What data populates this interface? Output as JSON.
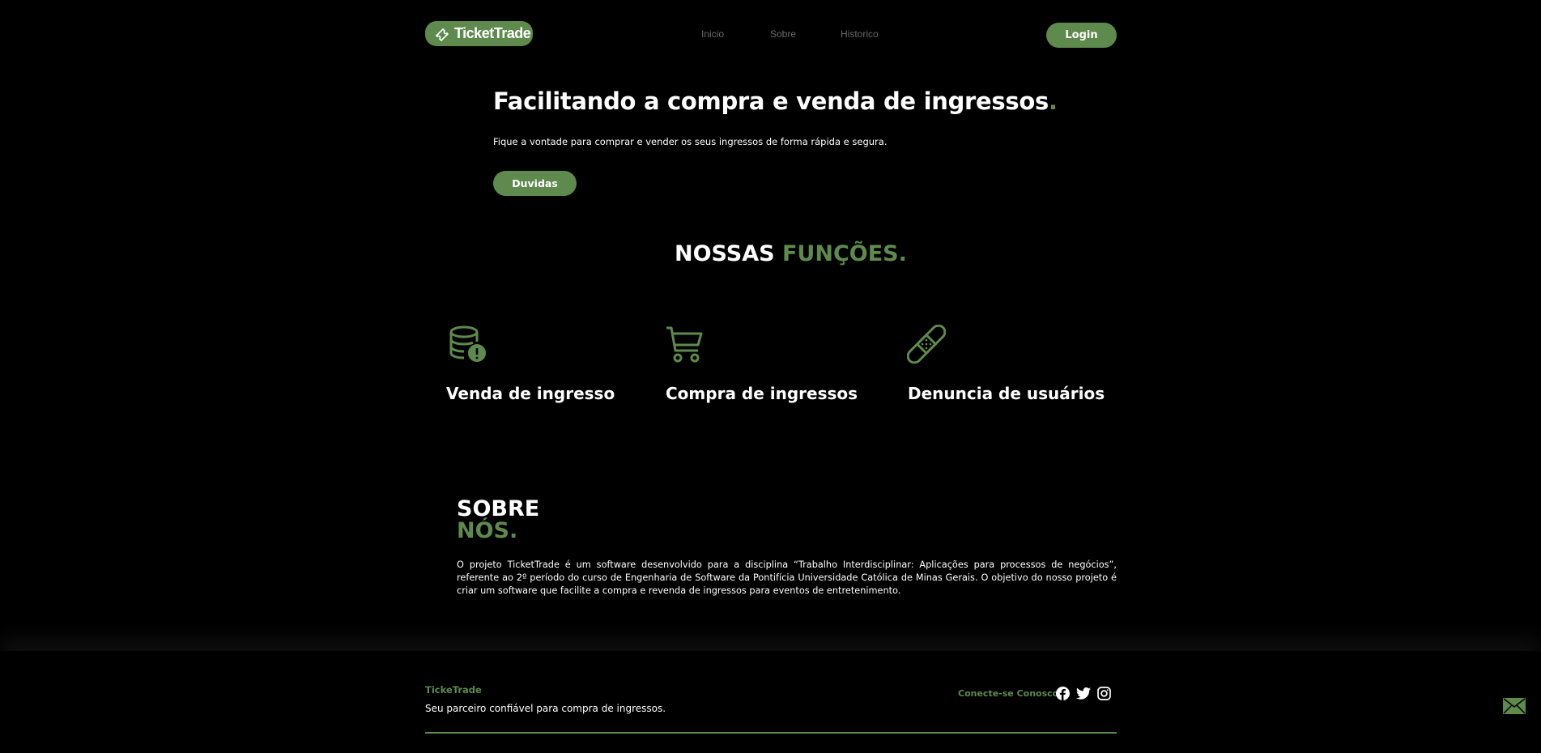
{
  "header": {
    "logo_text": "TicketTrade",
    "nav": [
      "Inicio",
      "Sobre",
      "Historico"
    ],
    "login_label": "Login"
  },
  "hero": {
    "title": "Facilitando a compra e venda de ingressos",
    "title_dot": ".",
    "subtitle": "Fique a vontade para comprar e vender os seus ingressos de forma rápida e segura.",
    "button_label": "Duvidas"
  },
  "features": {
    "title_white": "NOSSAS",
    "title_green": "FUNÇÕES.",
    "items": [
      {
        "label": "Venda de ingresso",
        "icon": "database-alert-icon"
      },
      {
        "label": "Compra de ingressos",
        "icon": "cart-icon"
      },
      {
        "label": "Denuncia de usuários",
        "icon": "bandage-icon"
      }
    ]
  },
  "about": {
    "title_white": "SOBRE",
    "title_green": "NÓS.",
    "text": "O projeto TicketTrade é um software desenvolvido para a disciplina “Trabalho Interdisciplinar: Aplicações para processos de negócios”, referente ao 2º período do curso de Engenharia de Software da Pontifícia Universidade Católica de Minas Gerais. O objetivo do nosso projeto é criar um software que facilite a compra e revenda de ingressos para eventos de entretenimento."
  },
  "footer": {
    "brand": "TickeTrade",
    "tagline": "Seu parceiro confiável para compra de ingressos.",
    "connect_label": "Conecte-se Conosco",
    "social": [
      "facebook-icon",
      "twitter-icon",
      "instagram-icon"
    ]
  },
  "colors": {
    "accent": "#5e8a4d",
    "background": "#000000",
    "nav_text": "#6a6a6a"
  }
}
